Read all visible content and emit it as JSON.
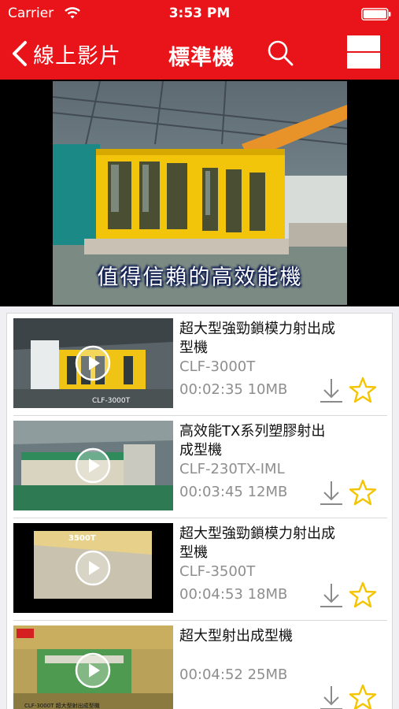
{
  "status_bar": {
    "carrier": "Carrier",
    "time": "3:53 PM",
    "wifi_icon": "wifi-icon",
    "battery_icon": "battery-icon"
  },
  "nav": {
    "back_label": "線上影片",
    "title": "標準機",
    "search_icon": "search-icon",
    "menu_icon": "menu-icon"
  },
  "player": {
    "caption": "值得信賴的高效能機"
  },
  "videos": [
    {
      "title": "超大型強勁鎖模力射出成型機",
      "model": "CLF-3000T",
      "duration": "00:02:35",
      "size": "10MB",
      "thumb_label": "CLF-3000T"
    },
    {
      "title": "高效能TX系列塑膠射出成型機",
      "model": "CLF-230TX-IML",
      "duration": "00:03:45",
      "size": "12MB",
      "thumb_label": ""
    },
    {
      "title": "超大型強勁鎖模力射出成型機",
      "model": "CLF-3500T",
      "duration": "00:04:53",
      "size": "18MB",
      "thumb_label": "3500T"
    },
    {
      "title": "超大型射出成型機",
      "model": "",
      "duration": "00:04:52",
      "size": "25MB",
      "thumb_label": "CLF-3000T 超大型射出成型機"
    }
  ],
  "colors": {
    "brand_red": "#e8141a",
    "star_yellow": "#f5c400",
    "text_gray": "#8e8e8e"
  }
}
